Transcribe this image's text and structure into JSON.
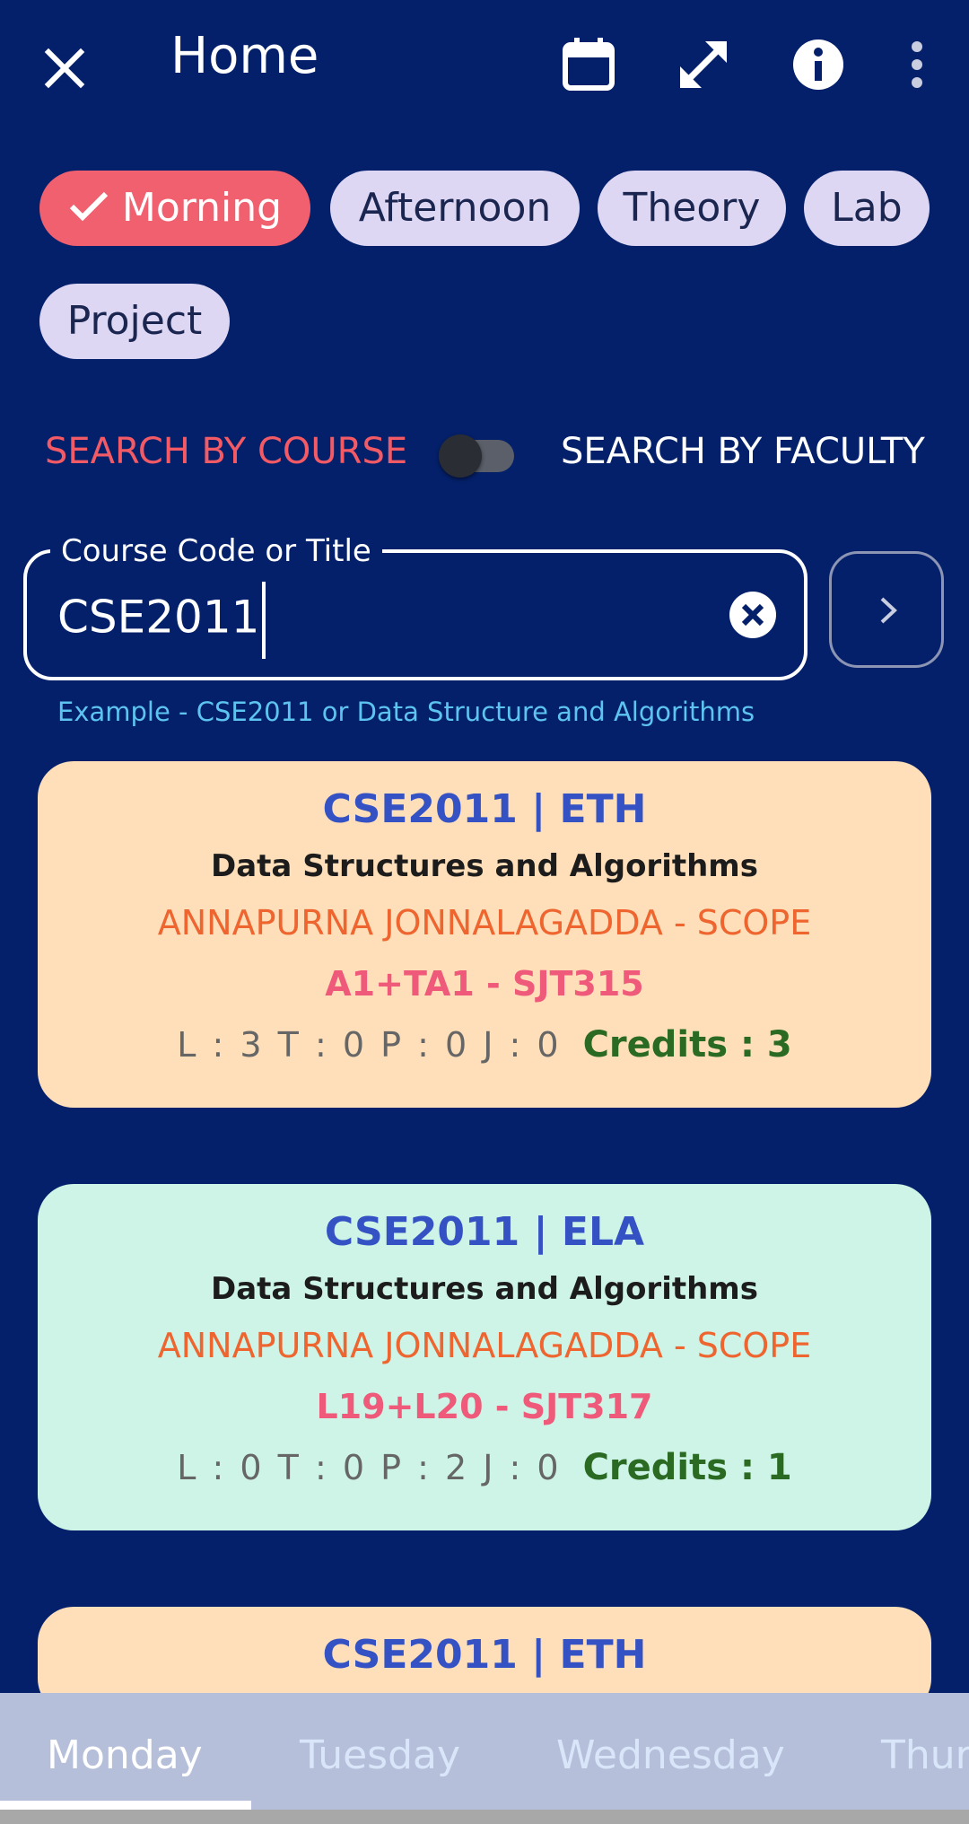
{
  "appbar": {
    "title": "Home",
    "icons": [
      "close-icon",
      "calendar-icon",
      "expand-icon",
      "info-icon",
      "more-icon"
    ]
  },
  "filters": {
    "chips": [
      {
        "label": "Morning",
        "selected": true
      },
      {
        "label": "Afternoon",
        "selected": false
      },
      {
        "label": "Theory",
        "selected": false
      },
      {
        "label": "Lab",
        "selected": false
      },
      {
        "label": "Project",
        "selected": false
      }
    ]
  },
  "search_mode": {
    "course_label": "SEARCH BY COURSE",
    "faculty_label": "SEARCH BY FACULTY",
    "faculty_mode": false
  },
  "search": {
    "label": "Course Code or Title",
    "value": "CSE2011",
    "helper": "Example - CSE2011 or Data Structure and Algorithms"
  },
  "results": [
    {
      "code": "CSE2011 | ETH",
      "name": "Data Structures and Algorithms",
      "faculty": "ANNAPURNA JONNALAGADDA - SCOPE",
      "slot": "A1+TA1 - SJT315",
      "ltpj": "L : 3   T : 0   P : 0   J : 0",
      "credits": "Credits : 3",
      "color": "#fedfb9"
    },
    {
      "code": "CSE2011 | ELA",
      "name": "Data Structures and Algorithms",
      "faculty": "ANNAPURNA JONNALAGADDA - SCOPE",
      "slot": "L19+L20 - SJT317",
      "ltpj": "L : 0   T : 0   P : 2   J : 0",
      "credits": "Credits : 1",
      "color": "#cdf4e6"
    },
    {
      "code": "CSE2011 | ETH",
      "color": "#fedfb9"
    }
  ],
  "tabs": {
    "items": [
      "Monday",
      "Tuesday",
      "Wednesday",
      "Thur"
    ],
    "active": "Monday"
  },
  "colors": {
    "background": "#04206a",
    "chip_selected": "#f0606f",
    "chip": "#ddd7f3",
    "accent_red": "#f25a66"
  }
}
